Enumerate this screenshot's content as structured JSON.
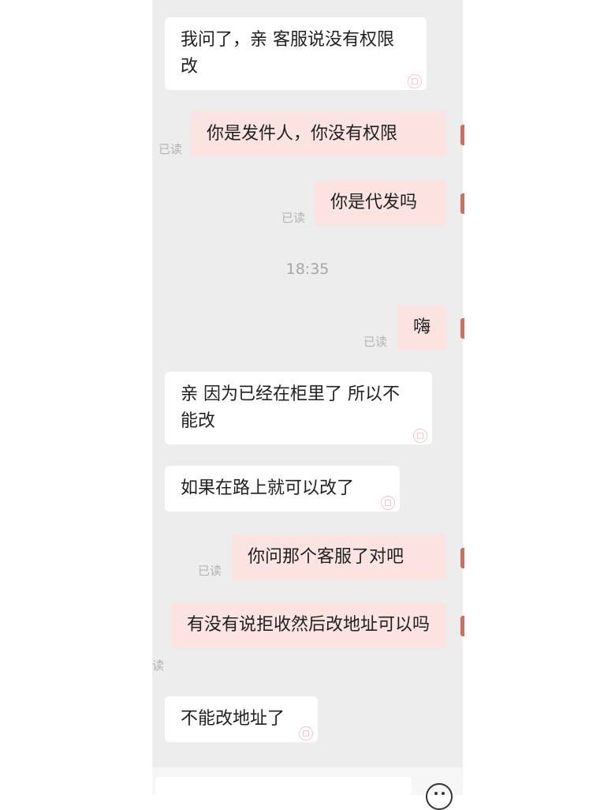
{
  "messages": [
    {
      "text": "我问了，亲 客服说没有权限改",
      "side": "in"
    },
    {
      "text": "你是发件人，你没有权限",
      "side": "out",
      "read": "已读"
    },
    {
      "text": "你是代发吗",
      "side": "out",
      "read": "已读"
    },
    {
      "text": "嗨",
      "side": "out",
      "read": "已读"
    },
    {
      "text": "亲 因为已经在柜里了 所以不能改",
      "side": "in"
    },
    {
      "text": "如果在路上就可以改了",
      "side": "in"
    },
    {
      "text": "你问那个客服了对吧",
      "side": "out",
      "read": "已读"
    },
    {
      "text": "有没有说拒收然后改地址可以吗",
      "side": "out",
      "read": "读"
    },
    {
      "text": "不能改地址了",
      "side": "in"
    }
  ],
  "timestamp": "18:35",
  "colors": {
    "chat_bg": "#ededed",
    "incoming_bubble": "#ffffff",
    "outgoing_bubble": "#fbe3e1",
    "read_receipt": "#b3b3b3"
  },
  "icons": {
    "emoji": "smiley-face-icon",
    "seal": "heart-seal-icon"
  }
}
